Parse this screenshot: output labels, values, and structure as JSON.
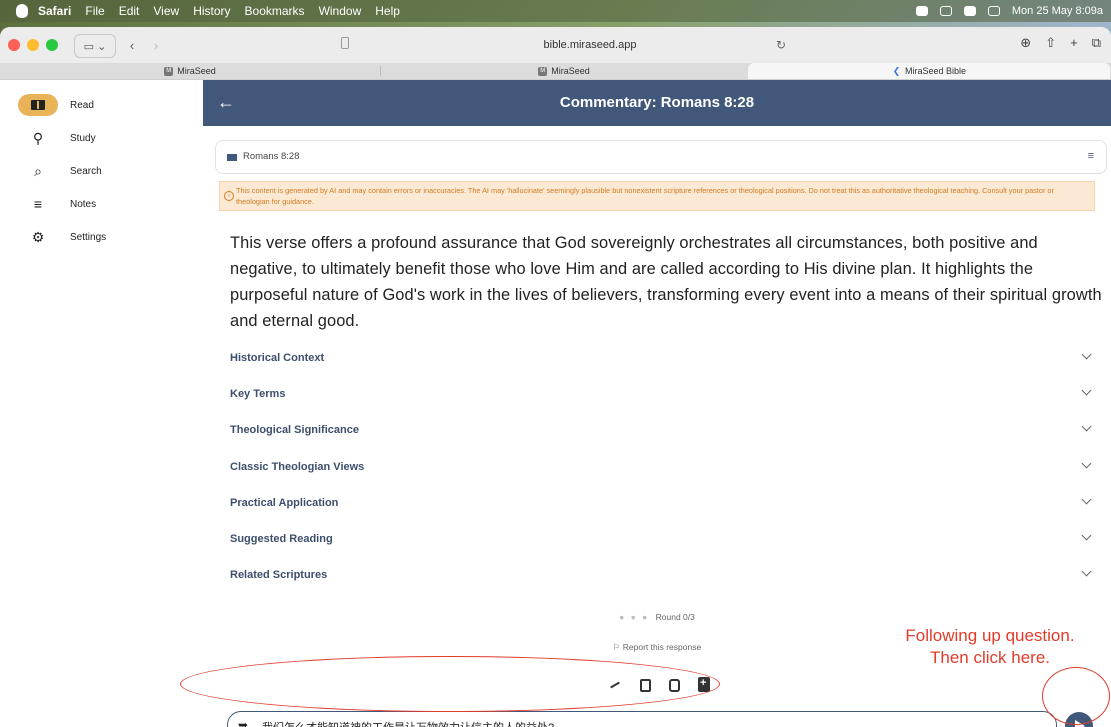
{
  "menubar": {
    "app": "Safari",
    "items": [
      "File",
      "Edit",
      "View",
      "History",
      "Bookmarks",
      "Window",
      "Help"
    ],
    "clock": "Mon 25 May 8:09a"
  },
  "browser": {
    "url": "bible.miraseed.app",
    "tabs": [
      {
        "label": "MiraSeed",
        "favicon": "M"
      },
      {
        "label": "MiraSeed",
        "favicon": "M"
      },
      {
        "label": "MiraSeed Bible",
        "active": true
      }
    ]
  },
  "sidebar": {
    "items": [
      {
        "label": "Read",
        "icon": "book-icon",
        "active": true
      },
      {
        "label": "Study",
        "icon": "lightbulb-icon"
      },
      {
        "label": "Search",
        "icon": "search-icon"
      },
      {
        "label": "Notes",
        "icon": "notes-icon"
      },
      {
        "label": "Settings",
        "icon": "gear-icon"
      }
    ]
  },
  "header": {
    "title": "Commentary: Romans 8:28"
  },
  "reference": {
    "label": "Romans 8:28"
  },
  "warning": {
    "text": "This content is generated by AI and may contain errors or inaccuracies. The AI may 'hallucinate' seemingly plausible but nonexistent scripture references or theological positions. Do not treat this as authoritative theological teaching. Consult your pastor or theologian for guidance."
  },
  "summary": "This verse offers a profound assurance that God sovereignly orchestrates all circumstances, both positive and negative, to ultimately benefit those who love Him and are called according to His divine plan. It highlights the purposeful nature of God's work in the lives of believers, transforming every event into a means of their spiritual growth and eternal good.",
  "sections": [
    "Historical Context",
    "Key Terms",
    "Theological Significance",
    "Classic Theologian Views",
    "Practical Application",
    "Suggested Reading",
    "Related Scriptures"
  ],
  "round": "Round 0/3",
  "report": "Report this response",
  "input": {
    "value": "我们怎么才能知道神的工作是让万物效力让信主的人的益处?"
  },
  "annotation": {
    "line1": "Following up question.",
    "line2": "Then click here."
  },
  "colors": {
    "header": "#42587b",
    "accent": "#e9b357",
    "warning_text": "#d27b1f",
    "annotation": "#e23b2a"
  }
}
